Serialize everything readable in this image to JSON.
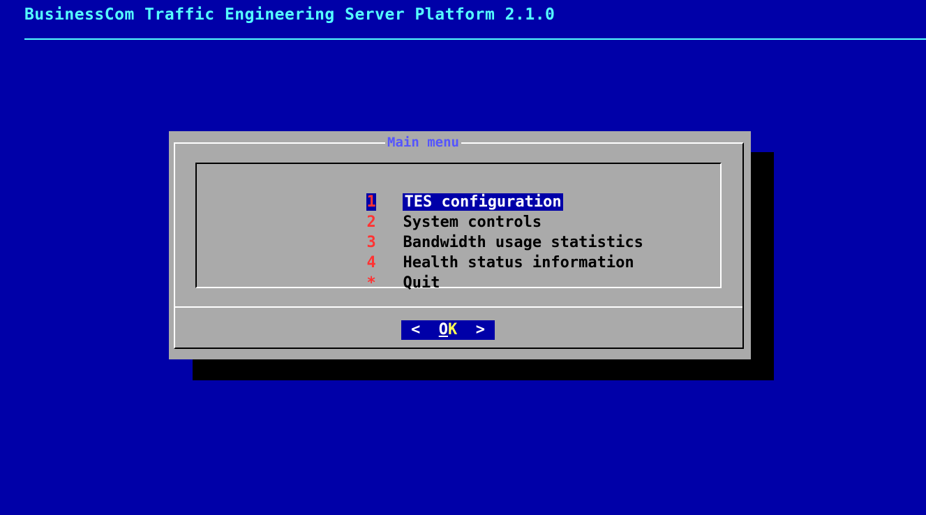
{
  "backtitle": "BusinessCom Traffic Engineering Server Platform 2.1.0",
  "dialog": {
    "title": "Main menu",
    "items": [
      {
        "tag": "1",
        "label": "TES configuration",
        "selected": true
      },
      {
        "tag": "2",
        "label": "System controls",
        "selected": false
      },
      {
        "tag": "3",
        "label": "Bandwidth usage statistics",
        "selected": false
      },
      {
        "tag": "4",
        "label": "Health status information",
        "selected": false
      },
      {
        "tag": "*",
        "label": "Quit",
        "selected": false
      }
    ],
    "ok_button": {
      "left": "<",
      "o": "O",
      "k": "K",
      "right": ">"
    }
  },
  "colors": {
    "background": "#0000a8",
    "backtitle": "#55ffff",
    "dialog": "#aaaaaa",
    "title": "#5555ff",
    "tag": "#ff3333",
    "hotkey": "#ffff55"
  }
}
